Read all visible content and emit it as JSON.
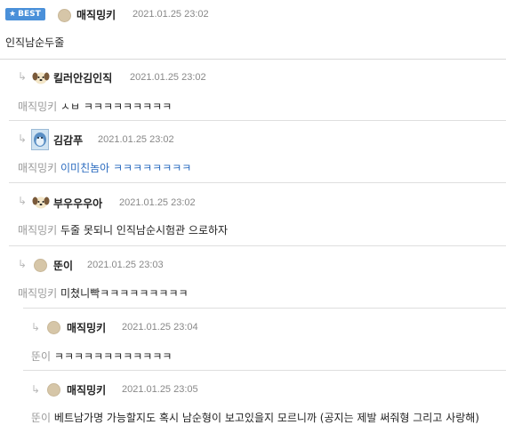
{
  "best": {
    "badge_label": "BEST",
    "nickname": "매직밍키",
    "date": "2021.01.25 23:02",
    "body": "인직남순두줄"
  },
  "replies": [
    {
      "nickname": "킬러안김인직",
      "date": "2021.01.25 23:02",
      "mention": "매직밍키",
      "body": "ㅅㅂ ㅋㅋㅋㅋㅋㅋㅋㅋㅋ",
      "avatar": "puppy-avatar"
    },
    {
      "nickname": "김감푸",
      "date": "2021.01.25 23:02",
      "mention": "매직밍키",
      "body": "이미친놈아 ㅋㅋㅋㅋㅋㅋㅋㅋ",
      "avatar": "blue-character-avatar",
      "link_color": "#2a6bbf"
    },
    {
      "nickname": "부우우우아",
      "date": "2021.01.25 23:02",
      "mention": "매직밍키",
      "body": "두줄 못되니 인직남순시험관 으로하자",
      "avatar": "puppy-avatar"
    },
    {
      "nickname": "뚠이",
      "date": "2021.01.25 23:03",
      "mention": "매직밍키",
      "body": "미쳤니빡ㅋㅋㅋㅋㅋㅋㅋㅋㅋ",
      "avatar": "default-avatar"
    },
    {
      "nickname": "매직밍키",
      "date": "2021.01.25 23:04",
      "mention": "뚠이",
      "body": "ㅋㅋㅋㅋㅋㅋㅋㅋㅋㅋㅋㅋ",
      "avatar": "default-avatar"
    },
    {
      "nickname": "매직밍키",
      "date": "2021.01.25 23:05",
      "mention": "뚠이",
      "body": "베트남가명 가능할지도 혹시 남순형이 보고있을지 모르니까 (공지는 제발 써줘형 그리고 사랑해)",
      "avatar": "default-avatar"
    }
  ],
  "colors": {
    "badge": "#4a90d9",
    "divider": "#dedede",
    "mention": "#999999",
    "date": "#888888"
  }
}
